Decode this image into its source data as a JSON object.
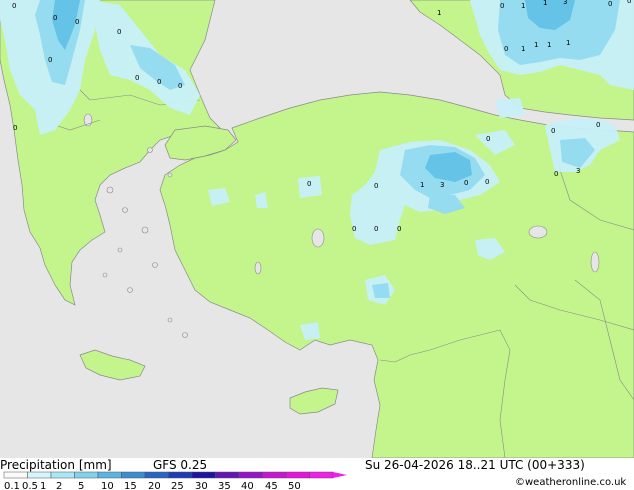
{
  "map": {
    "colors": {
      "sea": "#e6e6e6",
      "land": "#c3f58c",
      "coast": "#8a8a8a",
      "precip_light": "#c8f0fa",
      "precip_mid": "#96dcf0",
      "precip_heavy": "#64c3e6"
    },
    "value_labels": [
      "0",
      "0",
      "0",
      "0",
      "0",
      "0",
      "0",
      "0",
      "0",
      "0",
      "0",
      "0",
      "0",
      "1",
      "1",
      "1",
      "1",
      "1",
      "1",
      "1",
      "1",
      "3",
      "3",
      "3",
      "0",
      "0",
      "0",
      "0",
      "0",
      "0",
      "0",
      "0",
      "0",
      "0",
      "0"
    ]
  },
  "footer": {
    "title": "Precipitation [mm]",
    "model": "GFS 0.25",
    "datetime": "Su 26-04-2026 18..21 UTC (00+333)",
    "credit": "©weatheronline.co.uk"
  },
  "legend": {
    "ticks": [
      "0.1",
      "0.5",
      "1",
      "2",
      "5",
      "10",
      "15",
      "20",
      "25",
      "30",
      "35",
      "40",
      "45",
      "50"
    ],
    "colors": [
      "#fafafa",
      "#d2f5ff",
      "#aae6f5",
      "#82d2eb",
      "#5ab4e1",
      "#3c8cd2",
      "#2864c3",
      "#1e3cb4",
      "#1e14a0",
      "#6414b4",
      "#9614c8",
      "#c814d2",
      "#e614dc",
      "#f01ee6"
    ]
  }
}
